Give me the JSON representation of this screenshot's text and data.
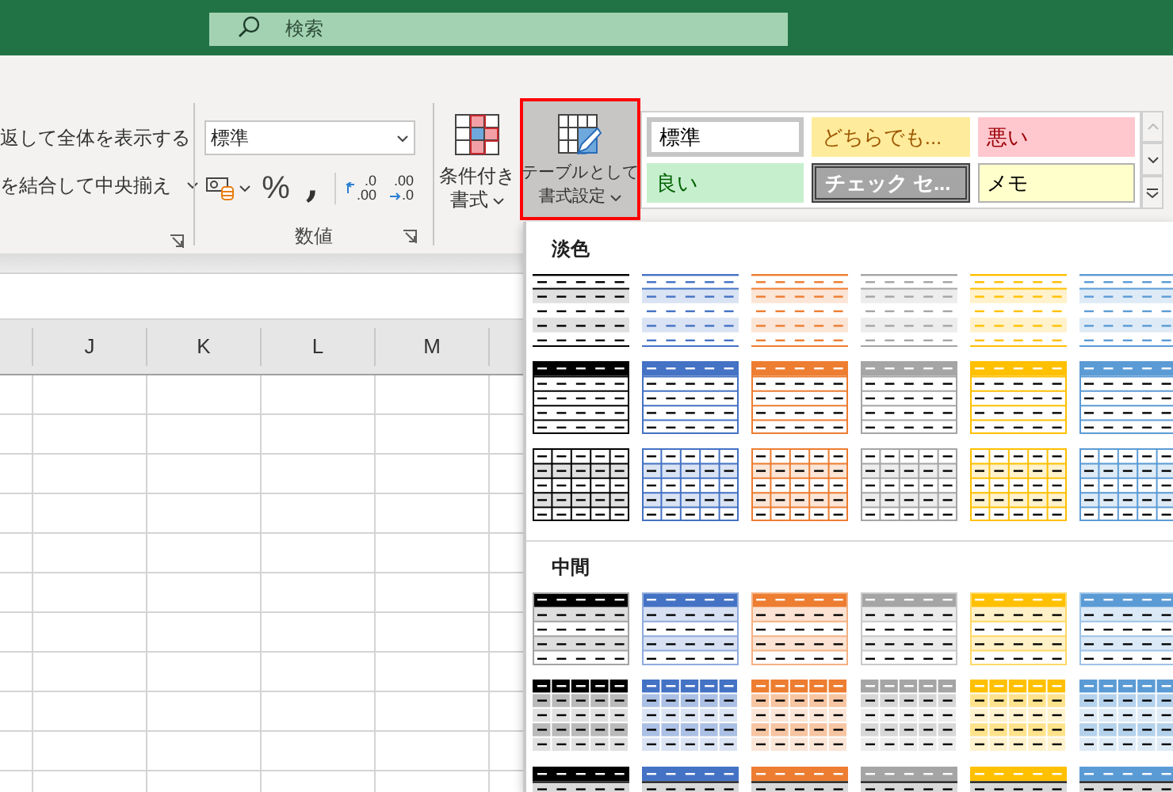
{
  "title_bar": {
    "search": {
      "placeholder": "検索"
    }
  },
  "ribbon": {
    "alignment_group": {
      "items": [
        {
          "label": "返して全体を表示する",
          "dropdown": false
        },
        {
          "label": "を結合して中央揃え",
          "dropdown": true
        }
      ]
    },
    "number_group": {
      "format": {
        "value": "標準"
      },
      "percent": "%",
      "comma": ",",
      "increase_decimal": {
        "top": ".0",
        "bottom": ".00"
      },
      "decrease_decimal": {
        "top": ".00",
        "bottom": ".0"
      },
      "label": "数値"
    },
    "conditional_format": {
      "lines": [
        "条件付き",
        "書式"
      ]
    },
    "table_format": {
      "lines": [
        "テーブルとして",
        "書式設定"
      ],
      "pressed": true,
      "highlighted": true
    },
    "cell_styles": [
      {
        "label": "標準",
        "kind": "normal"
      },
      {
        "label": "どちらでも...",
        "kind": "neutral"
      },
      {
        "label": "悪い",
        "kind": "bad"
      },
      {
        "label": "良い",
        "kind": "good"
      },
      {
        "label": "チェック セ...",
        "kind": "check"
      },
      {
        "label": "メモ",
        "kind": "note"
      }
    ]
  },
  "sheet": {
    "columns": [
      "J",
      "K",
      "L",
      "M"
    ]
  },
  "table_styles": {
    "sections": [
      {
        "label": "淡色",
        "rows": [
          {
            "kind": "banded",
            "styles": [
              {
                "color": "#000000"
              },
              {
                "color": "#4472c4"
              },
              {
                "color": "#ed7d31"
              },
              {
                "color": "#a5a5a5"
              },
              {
                "color": "#ffc000"
              },
              {
                "color": "#5b9bd5"
              }
            ]
          },
          {
            "kind": "header-grid",
            "styles": [
              {
                "color": "#000000"
              },
              {
                "color": "#4472c4"
              },
              {
                "color": "#ed7d31"
              },
              {
                "color": "#a5a5a5"
              },
              {
                "color": "#ffc000"
              },
              {
                "color": "#5b9bd5"
              }
            ]
          },
          {
            "kind": "full-grid",
            "styles": [
              {
                "color": "#000000"
              },
              {
                "color": "#4472c4"
              },
              {
                "color": "#ed7d31"
              },
              {
                "color": "#a5a5a5"
              },
              {
                "color": "#ffc000"
              },
              {
                "color": "#5b9bd5"
              }
            ]
          }
        ]
      },
      {
        "label": "中間",
        "rows": [
          {
            "kind": "header-banded",
            "styles": [
              {
                "color": "#000000"
              },
              {
                "color": "#4472c4"
              },
              {
                "color": "#ed7d31"
              },
              {
                "color": "#a5a5a5"
              },
              {
                "color": "#ffc000"
              },
              {
                "color": "#5b9bd5"
              }
            ]
          },
          {
            "kind": "header-cells-banded",
            "styles": [
              {
                "color": "#000000"
              },
              {
                "color": "#4472c4"
              },
              {
                "color": "#ed7d31"
              },
              {
                "color": "#a5a5a5"
              },
              {
                "color": "#ffc000"
              },
              {
                "color": "#5b9bd5"
              }
            ]
          },
          {
            "kind": "header-rule",
            "styles": [
              {
                "color": "#000000"
              },
              {
                "color": "#4472c4"
              },
              {
                "color": "#ed7d31"
              },
              {
                "color": "#a5a5a5"
              },
              {
                "color": "#ffc000"
              },
              {
                "color": "#5b9bd5"
              }
            ]
          }
        ]
      }
    ]
  }
}
